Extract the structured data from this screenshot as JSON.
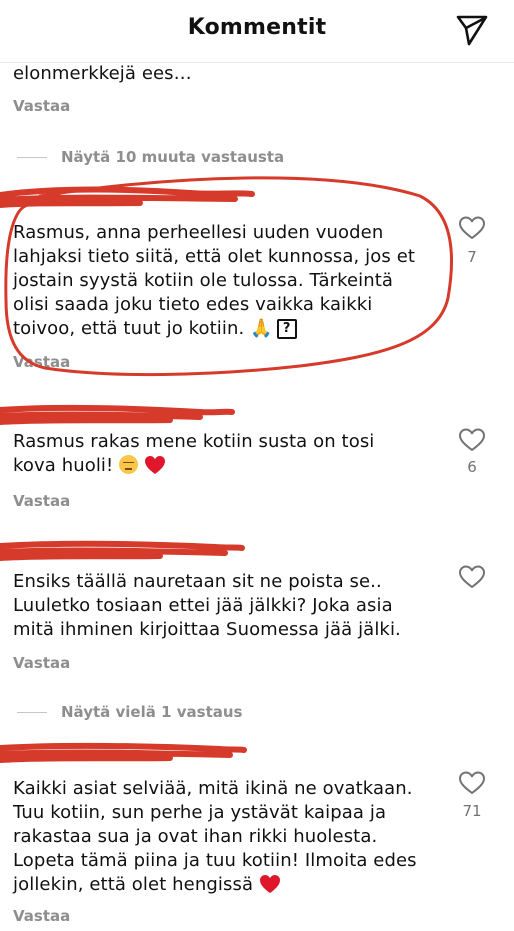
{
  "header": {
    "title": "Kommentit",
    "send_icon": "paper-plane-icon"
  },
  "comments": [
    {
      "text": "elonmerkkejä  ees…",
      "reply": "Vastaa"
    },
    {
      "text": "Rasmus, anna perheellesi uuden vuoden\nlahjaksi tieto siitä, että olet kunnossa, jos et\njostain syystä kotiin ole tulossa. Tärkeintä\nolisi saada joku tieto edes vaikka kaikki\ntoivoo, että tuut jo kotiin.",
      "emoji_praying": "🙏",
      "emoji_missing": "?",
      "likes": "7",
      "reply": "Vastaa"
    },
    {
      "text": "Rasmus rakas mene kotiin susta on tosi\nkova huoli!",
      "likes": "6",
      "reply": "Vastaa"
    },
    {
      "text": "Ensiks täällä nauretaan sit ne poista se..\nLuuletko tosiaan ettei jää jälkki? Joka asia\nmitä ihminen kirjoittaa Suomessa jää jälki.",
      "reply": "Vastaa"
    },
    {
      "text": "Kaikki asiat selviää, mitä ikinä ne ovatkaan.\nTuu kotiin, sun perhe ja ystävät kaipaa ja\nrakastaa sua ja ovat ihan rikki huolesta.\nLopeta tämä piina ja tuu kotiin! Ilmoita edes\njollekin, että olet hengissä",
      "likes": "71",
      "reply": "Vastaa"
    }
  ],
  "more_replies": [
    "Näytä 10 muuta vastausta",
    "Näytä vielä 1 vastaus"
  ],
  "colors": {
    "annotation_red": "#d63a2a",
    "muted_text": "#8e8e8e",
    "heart_red": "#e0162b"
  }
}
